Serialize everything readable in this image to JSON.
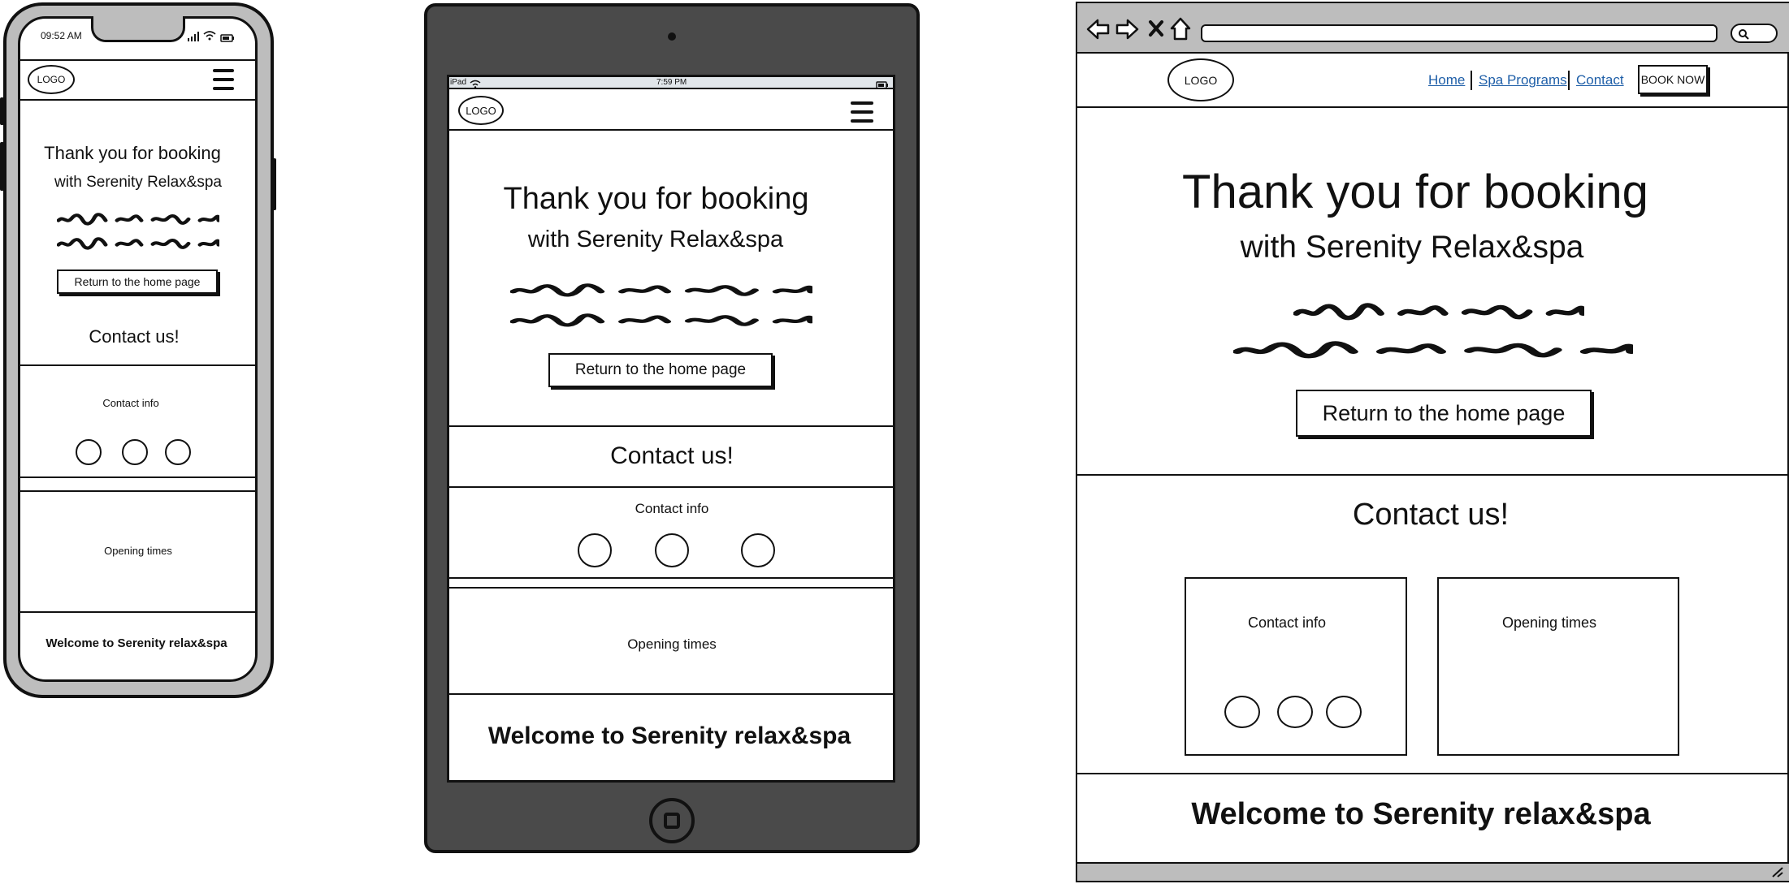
{
  "phone": {
    "status_time": "09:52 AM",
    "logo": "LOGO",
    "heading_line1": "Thank you for booking",
    "heading_line2": "with Serenity Relax&spa",
    "return_button": "Return to the home page",
    "contact_heading": "Contact us!",
    "contact_info": "Contact info",
    "opening_times": "Opening times",
    "footer": "Welcome to Serenity relax&spa"
  },
  "tablet": {
    "status_left": "iPad",
    "status_time": "7:59 PM",
    "logo": "LOGO",
    "heading_line1": "Thank you for booking",
    "heading_line2": "with Serenity Relax&spa",
    "return_button": "Return to the home page",
    "contact_heading": "Contact us!",
    "contact_info": "Contact info",
    "opening_times": "Opening times",
    "footer": "Welcome to Serenity relax&spa"
  },
  "desktop": {
    "logo": "LOGO",
    "nav": {
      "home": "Home",
      "spa_programs": "Spa Programs",
      "contact": "Contact",
      "book_now": "BOOK NOW"
    },
    "heading_line1": "Thank you for booking",
    "heading_line2": "with Serenity Relax&spa",
    "return_button": "Return to the home page",
    "contact_heading": "Contact us!",
    "contact_info": "Contact info",
    "opening_times": "Opening times",
    "footer": "Welcome to Serenity relax&spa"
  },
  "icons": {
    "back": "back-arrow-icon",
    "forward": "forward-arrow-icon",
    "close": "close-icon",
    "home": "home-icon",
    "search": "search-icon",
    "menu": "hamburger-menu-icon",
    "signal": "signal-icon",
    "wifi": "wifi-icon",
    "battery": "battery-icon",
    "camera": "camera-icon",
    "home_button": "home-button-icon",
    "resize": "resize-grip-icon"
  },
  "colors": {
    "device_frame": "#bdbdbd",
    "tablet_frame": "#4a4a4a",
    "link": "#1f5fa8",
    "ink": "#111111"
  }
}
